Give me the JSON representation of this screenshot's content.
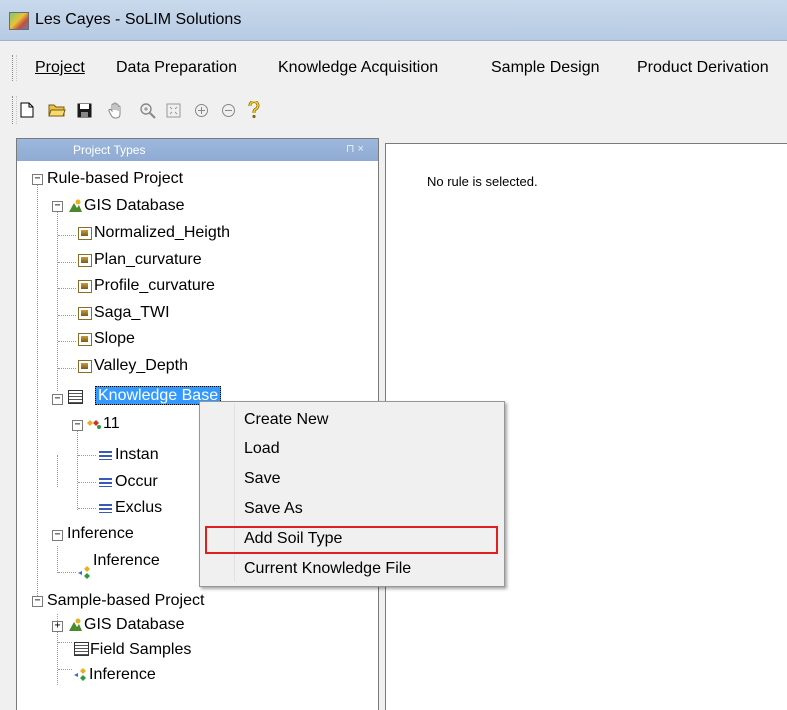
{
  "window": {
    "title": "Les Cayes - SoLIM Solutions"
  },
  "menubar": {
    "items": [
      {
        "label": "Project"
      },
      {
        "label": "Data Preparation"
      },
      {
        "label": "Knowledge Acquisition"
      },
      {
        "label": "Sample Design"
      },
      {
        "label": "Product Derivation"
      }
    ]
  },
  "toolbar": {
    "buttons": [
      {
        "name": "new-icon",
        "glyph": "🗋"
      },
      {
        "name": "open-icon",
        "glyph": "📂"
      },
      {
        "name": "save-icon",
        "glyph": "💾"
      },
      {
        "name": "pan-icon",
        "glyph": "✋"
      },
      {
        "name": "zoom-window-icon",
        "glyph": "🔍"
      },
      {
        "name": "zoom-extent-icon",
        "glyph": "⛶"
      },
      {
        "name": "zoom-in-icon",
        "glyph": "⊕"
      },
      {
        "name": "zoom-out-icon",
        "glyph": "⊖"
      },
      {
        "name": "help-icon",
        "glyph": "?"
      }
    ]
  },
  "left_panel": {
    "header": "Project Types",
    "pin": "⊓ ×",
    "tree": {
      "rule_project": "Rule-based Project",
      "gis_database": "GIS Database",
      "layers": [
        "Normalized_Heigth",
        "Plan_curvature",
        "Profile_curvature",
        "Saga_TWI",
        "Slope",
        "Valley_Depth"
      ],
      "knowledge_base": "Knowledge Base",
      "kb_child": "11",
      "rules": [
        "Instan",
        "Occur",
        "Exclus"
      ],
      "inference": "Inference",
      "inference_child": "Inference",
      "sample_project": "Sample-based Project",
      "sample_gis": "GIS Database",
      "field_samples": "Field Samples",
      "sample_inference": "Inference"
    }
  },
  "right_panel": {
    "message": "No rule is selected."
  },
  "context_menu": {
    "items": [
      "Create New",
      "Load",
      "Save",
      "Save As",
      "Add Soil Type",
      "Current Knowledge File"
    ],
    "highlighted": "Add Soil Type",
    "highlight_color": "#e02020"
  },
  "colors": {
    "selection": "#3399ff",
    "panel_header": "#9db8dd"
  }
}
